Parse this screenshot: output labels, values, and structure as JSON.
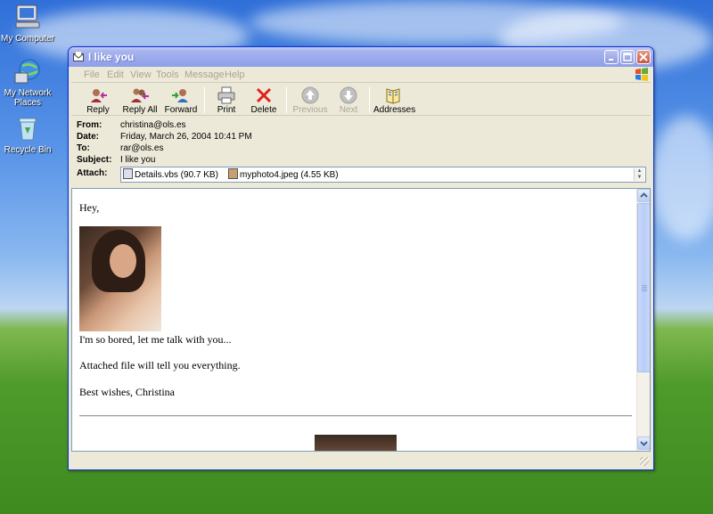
{
  "desktop": {
    "icons": [
      {
        "label": "My Computer"
      },
      {
        "label": "My Network Places"
      },
      {
        "label": "Recycle Bin"
      }
    ]
  },
  "window": {
    "title": "I like you",
    "menu": [
      "File",
      "Edit",
      "View",
      "Tools",
      "Message",
      "Help"
    ],
    "toolbar": {
      "reply": "Reply",
      "reply_all": "Reply All",
      "forward": "Forward",
      "print": "Print",
      "delete": "Delete",
      "previous": "Previous",
      "next": "Next",
      "addresses": "Addresses"
    },
    "headers": {
      "from_label": "From:",
      "from": "christina@ols.es",
      "date_label": "Date:",
      "date": "Friday, March 26, 2004 10:41 PM",
      "to_label": "To:",
      "to": "rar@ols.es",
      "subject_label": "Subject:",
      "subject": "I like you",
      "attach_label": "Attach:",
      "attachments": [
        {
          "name": "Details.vbs (90.7 KB)"
        },
        {
          "name": "myphoto4.jpeg (4.55 KB)"
        }
      ]
    },
    "body": {
      "greeting": "Hey,",
      "line1": "I'm so bored, let me talk with you...",
      "line2": "Attached file will tell you everything.",
      "signoff": "Best wishes, Christina"
    }
  },
  "colors": {
    "title_bar": "#9aa9ec",
    "window_bg": "#ece9d8",
    "border_blue": "#0831d9",
    "disabled_text": "#a8a597"
  }
}
